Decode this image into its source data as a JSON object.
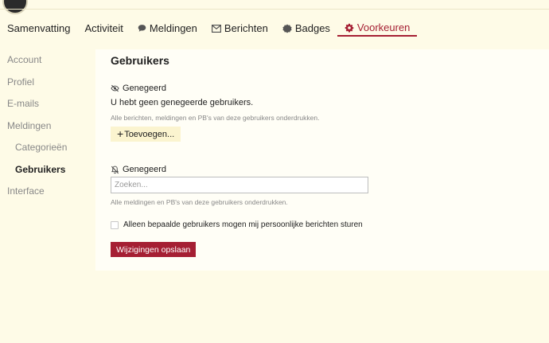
{
  "nav": {
    "tabs": [
      {
        "label": "Samenvatting",
        "icon": ""
      },
      {
        "label": "Activiteit",
        "icon": ""
      },
      {
        "label": "Meldingen",
        "icon": "speech-bubble-icon"
      },
      {
        "label": "Berichten",
        "icon": "envelope-icon"
      },
      {
        "label": "Badges",
        "icon": "badge-icon"
      },
      {
        "label": "Voorkeuren",
        "icon": "gear-icon"
      }
    ],
    "active": "Voorkeuren"
  },
  "sidebar": {
    "items": [
      {
        "label": "Account"
      },
      {
        "label": "Profiel"
      },
      {
        "label": "E-mails"
      },
      {
        "label": "Meldingen"
      },
      {
        "label": "Categorieën"
      },
      {
        "label": "Gebruikers"
      },
      {
        "label": "Interface"
      }
    ],
    "active": "Gebruikers"
  },
  "main": {
    "title": "Gebruikers",
    "ignored": {
      "heading": "Genegeerd",
      "icon": "eye-slash-icon",
      "empty_message": "U hebt geen genegeerde gebruikers.",
      "hint": "Alle berichten, meldingen en PB's van deze gebruikers onderdrukken.",
      "add_label": "Toevoegen..."
    },
    "muted": {
      "heading": "Genegeerd",
      "icon": "bell-slash-icon",
      "search_placeholder": "Zoeken...",
      "hint": "Alle meldingen en PB's van deze gebruikers onderdrukken."
    },
    "allow_pm_label": "Alleen bepaalde gebruikers mogen mij persoonlijke berichten sturen",
    "allow_pm_checked": false,
    "save_label": "Wijzigingen opslaan"
  },
  "colors": {
    "accent": "#a51f33",
    "background": "#fefbe7",
    "panel": "#fffef6",
    "button_bg": "#fbf4cf"
  }
}
